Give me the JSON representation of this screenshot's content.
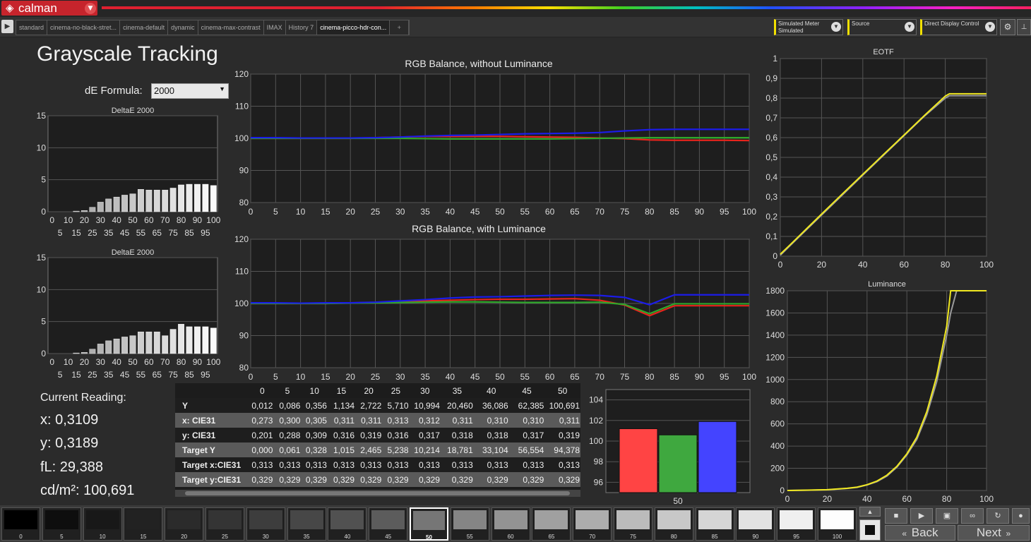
{
  "app": {
    "name": "calman"
  },
  "tabs": [
    "standard",
    "cinema-no-black-stret...",
    "cinema-default",
    "dynamic",
    "cinema-max-contrast",
    "IMAX",
    "History 7",
    "cinema-picco-hdr-con..."
  ],
  "active_tab": 7,
  "controls": {
    "meter": {
      "label": "Simulated Meter",
      "value": "Simulated"
    },
    "source": {
      "label": "Source",
      "value": ""
    },
    "display": {
      "label": "Direct Display Control",
      "value": ""
    }
  },
  "page": {
    "title": "Grayscale Tracking"
  },
  "de_formula": {
    "label": "dE Formula:",
    "value": "2000"
  },
  "current_reading": {
    "title": "Current Reading:",
    "x": "x: 0,3109",
    "y": "y: 0,3189",
    "fl": "fL: 29,388",
    "cdm2": "cd/m²: 100,691"
  },
  "chart_data": [
    {
      "type": "bar",
      "title": "DeltaE 2000",
      "categories": [
        0,
        5,
        10,
        15,
        20,
        25,
        30,
        35,
        40,
        45,
        50,
        55,
        60,
        65,
        70,
        75,
        80,
        85,
        90,
        95,
        100
      ],
      "values": [
        0,
        0,
        0,
        0.1,
        0.2,
        0.7,
        1.5,
        2.0,
        2.3,
        2.6,
        2.8,
        3.5,
        3.4,
        3.4,
        3.4,
        3.7,
        4.2,
        4.3,
        4.3,
        4.3,
        4.1
      ],
      "ylim": [
        0,
        15
      ],
      "yticks": [
        0,
        5,
        10,
        15
      ],
      "xticks_top": [
        "0",
        "10",
        "20",
        "30",
        "40",
        "50",
        "60",
        "70",
        "80",
        "90",
        "100"
      ],
      "xticks_bottom": [
        "5",
        "15",
        "25",
        "35",
        "45",
        "55",
        "65",
        "75",
        "85",
        "95"
      ]
    },
    {
      "type": "line",
      "title": "RGB Balance, without Luminance",
      "x": [
        0,
        5,
        10,
        15,
        20,
        25,
        30,
        35,
        40,
        45,
        50,
        55,
        60,
        65,
        70,
        75,
        80,
        85,
        90,
        95,
        100
      ],
      "ylim": [
        80,
        120
      ],
      "yticks": [
        80,
        90,
        100,
        110,
        120
      ],
      "xticks": [
        "0",
        "5",
        "10",
        "15",
        "20",
        "25",
        "30",
        "35",
        "40",
        "45",
        "50",
        "55",
        "60",
        "65",
        "70",
        "75",
        "80",
        "85",
        "90",
        "95",
        "100"
      ],
      "series": [
        {
          "color": "#e8241c",
          "values": [
            100.0,
            100.0,
            100.0,
            100.0,
            100.0,
            100.2,
            100.4,
            100.6,
            100.6,
            100.6,
            100.6,
            100.5,
            100.4,
            100.3,
            100.1,
            99.9,
            99.5,
            99.4,
            99.4,
            99.4,
            99.3
          ]
        },
        {
          "color": "#2ea82a",
          "values": [
            100.0,
            100.0,
            100.0,
            100.0,
            100.0,
            100.0,
            100.0,
            99.9,
            99.8,
            99.8,
            99.8,
            99.8,
            99.8,
            99.9,
            100.0,
            100.1,
            100.2,
            100.2,
            100.2,
            100.2,
            100.2
          ]
        },
        {
          "color": "#1c1ce8",
          "values": [
            100.2,
            100.2,
            100.1,
            100.1,
            100.1,
            100.2,
            100.4,
            100.7,
            100.9,
            101.0,
            101.2,
            101.4,
            101.5,
            101.6,
            101.8,
            102.3,
            102.7,
            102.8,
            102.8,
            102.8,
            102.8
          ]
        }
      ]
    },
    {
      "type": "bar",
      "title": "DeltaE 2000",
      "categories": [
        0,
        5,
        10,
        15,
        20,
        25,
        30,
        35,
        40,
        45,
        50,
        55,
        60,
        65,
        70,
        75,
        80,
        85,
        90,
        95,
        100
      ],
      "values": [
        0,
        0,
        0,
        0.1,
        0.2,
        0.7,
        1.5,
        2.0,
        2.3,
        2.6,
        2.8,
        3.4,
        3.4,
        3.4,
        2.8,
        3.8,
        4.6,
        4.2,
        4.2,
        4.2,
        4.0
      ],
      "ylim": [
        0,
        15
      ],
      "yticks": [
        0,
        5,
        10,
        15
      ],
      "xticks_top": [
        "0",
        "10",
        "20",
        "30",
        "40",
        "50",
        "60",
        "70",
        "80",
        "90",
        "100"
      ],
      "xticks_bottom": [
        "5",
        "15",
        "25",
        "35",
        "45",
        "55",
        "65",
        "75",
        "85",
        "95"
      ]
    },
    {
      "type": "line",
      "title": "RGB Balance, with Luminance",
      "x": [
        0,
        5,
        10,
        15,
        20,
        25,
        30,
        35,
        40,
        45,
        50,
        55,
        60,
        65,
        70,
        75,
        80,
        85,
        90,
        95,
        100
      ],
      "ylim": [
        80,
        120
      ],
      "yticks": [
        80,
        90,
        100,
        110,
        120
      ],
      "xticks": [
        "0",
        "5",
        "10",
        "15",
        "20",
        "25",
        "30",
        "35",
        "40",
        "45",
        "50",
        "55",
        "60",
        "65",
        "70",
        "75",
        "80",
        "85",
        "90",
        "95",
        "100"
      ],
      "series": [
        {
          "color": "#e8241c",
          "values": [
            100.0,
            100.0,
            100.0,
            100.0,
            100.2,
            100.3,
            100.6,
            100.8,
            101.0,
            101.2,
            101.3,
            101.3,
            101.4,
            101.5,
            101.0,
            99.5,
            96.2,
            99.3,
            99.3,
            99.3,
            99.3
          ]
        },
        {
          "color": "#2ea82a",
          "values": [
            100.0,
            100.0,
            100.0,
            100.0,
            100.1,
            100.2,
            100.3,
            100.4,
            100.5,
            100.5,
            100.4,
            100.3,
            100.3,
            100.3,
            100.4,
            99.7,
            96.8,
            99.9,
            99.9,
            99.9,
            99.9
          ]
        },
        {
          "color": "#1c1ce8",
          "values": [
            100.2,
            100.2,
            100.1,
            100.2,
            100.2,
            100.4,
            100.8,
            101.2,
            101.7,
            102.0,
            102.1,
            102.3,
            102.5,
            102.6,
            102.5,
            101.9,
            99.6,
            102.7,
            102.7,
            102.7,
            102.7
          ]
        }
      ]
    },
    {
      "type": "line",
      "title": "EOTF",
      "x": [
        0,
        5,
        10,
        20,
        30,
        40,
        50,
        60,
        70,
        80,
        82,
        85,
        90,
        100
      ],
      "xlim": [
        0,
        100
      ],
      "ylim": [
        0,
        1
      ],
      "yticks": [
        "0",
        "0,1",
        "0,2",
        "0,3",
        "0,4",
        "0,5",
        "0,6",
        "0,7",
        "0,8",
        "0,9",
        "1"
      ],
      "xticks": [
        "0",
        "20",
        "40",
        "60",
        "80",
        "100"
      ],
      "series": [
        {
          "color": "#9a9a9a",
          "values": [
            0.005,
            0.056,
            0.107,
            0.208,
            0.309,
            0.41,
            0.51,
            0.61,
            0.71,
            0.8,
            0.812,
            0.812,
            0.812,
            0.812
          ]
        },
        {
          "color": "#f0e820",
          "values": [
            0.01,
            0.06,
            0.111,
            0.213,
            0.314,
            0.414,
            0.514,
            0.613,
            0.713,
            0.81,
            0.822,
            0.822,
            0.822,
            0.822
          ]
        }
      ]
    },
    {
      "type": "line",
      "title": "Luminance",
      "x": [
        0,
        10,
        20,
        30,
        35,
        40,
        45,
        50,
        55,
        60,
        65,
        70,
        75,
        80,
        82,
        85,
        90,
        100
      ],
      "xlim": [
        0,
        100
      ],
      "ylim": [
        0,
        1800
      ],
      "yticks": [
        "0",
        "200",
        "400",
        "600",
        "800",
        "1000",
        "1200",
        "1400",
        "1600",
        "1800"
      ],
      "xticks": [
        "0",
        "20",
        "40",
        "60",
        "80",
        "100"
      ],
      "series": [
        {
          "color": "#9a9a9a",
          "values": [
            0,
            2,
            6,
            18,
            28,
            50,
            80,
            130,
            210,
            320,
            460,
            680,
            980,
            1400,
            1600,
            1800,
            1800,
            1800
          ]
        },
        {
          "color": "#f0e820",
          "values": [
            0,
            3,
            7,
            20,
            30,
            52,
            85,
            138,
            218,
            330,
            480,
            710,
            1030,
            1480,
            1800,
            1800,
            1800,
            1800
          ]
        }
      ]
    },
    {
      "type": "bar",
      "title": "",
      "categories": [
        "50"
      ],
      "ylim": [
        95,
        105
      ],
      "yticks": [
        "96",
        "98",
        "100",
        "102",
        "104"
      ],
      "series": [
        {
          "color": "#ff4444",
          "values": [
            101.2
          ]
        },
        {
          "color": "#3fa83f",
          "values": [
            100.6
          ]
        },
        {
          "color": "#4444ff",
          "values": [
            101.9
          ]
        }
      ]
    }
  ],
  "table": {
    "columns": [
      "0",
      "5",
      "10",
      "15",
      "20",
      "25",
      "30",
      "35",
      "40",
      "45",
      "50"
    ],
    "rows": [
      {
        "label": "Y",
        "values": [
          "0,012",
          "0,086",
          "0,356",
          "1,134",
          "2,722",
          "5,710",
          "10,994",
          "20,460",
          "36,086",
          "62,385",
          "100,691"
        ]
      },
      {
        "label": "x: CIE31",
        "values": [
          "0,273",
          "0,300",
          "0,305",
          "0,311",
          "0,311",
          "0,313",
          "0,312",
          "0,311",
          "0,310",
          "0,310",
          "0,311"
        ]
      },
      {
        "label": "y: CIE31",
        "values": [
          "0,201",
          "0,288",
          "0,309",
          "0,316",
          "0,319",
          "0,316",
          "0,317",
          "0,318",
          "0,318",
          "0,317",
          "0,319"
        ]
      },
      {
        "label": "Target Y",
        "values": [
          "0,000",
          "0,061",
          "0,328",
          "1,015",
          "2,465",
          "5,238",
          "10,214",
          "18,781",
          "33,104",
          "56,554",
          "94,378"
        ]
      },
      {
        "label": "Target x:CIE31",
        "values": [
          "0,313",
          "0,313",
          "0,313",
          "0,313",
          "0,313",
          "0,313",
          "0,313",
          "0,313",
          "0,313",
          "0,313",
          "0,313"
        ]
      },
      {
        "label": "Target y:CIE31",
        "values": [
          "0,329",
          "0,329",
          "0,329",
          "0,329",
          "0,329",
          "0,329",
          "0,329",
          "0,329",
          "0,329",
          "0,329",
          "0,329"
        ]
      }
    ]
  },
  "swatches": [
    {
      "label": "0",
      "color": "#000000"
    },
    {
      "label": "5",
      "color": "#0e0e0e"
    },
    {
      "label": "10",
      "color": "#181818"
    },
    {
      "label": "15",
      "color": "#222222"
    },
    {
      "label": "20",
      "color": "#2b2b2b"
    },
    {
      "label": "25",
      "color": "#343434"
    },
    {
      "label": "30",
      "color": "#3d3d3d"
    },
    {
      "label": "35",
      "color": "#474747"
    },
    {
      "label": "40",
      "color": "#515151"
    },
    {
      "label": "45",
      "color": "#5c5c5c"
    },
    {
      "label": "50",
      "color": "#767676"
    },
    {
      "label": "55",
      "color": "#858585"
    },
    {
      "label": "60",
      "color": "#939393"
    },
    {
      "label": "65",
      "color": "#a0a0a0"
    },
    {
      "label": "70",
      "color": "#adadad"
    },
    {
      "label": "75",
      "color": "#bbbbbb"
    },
    {
      "label": "80",
      "color": "#c8c8c8"
    },
    {
      "label": "85",
      "color": "#d5d5d5"
    },
    {
      "label": "90",
      "color": "#e2e2e2"
    },
    {
      "label": "95",
      "color": "#efefef"
    },
    {
      "label": "100",
      "color": "#fdfdfd"
    }
  ],
  "selected_swatch": 10,
  "nav": {
    "back": "Back",
    "next": "Next"
  }
}
